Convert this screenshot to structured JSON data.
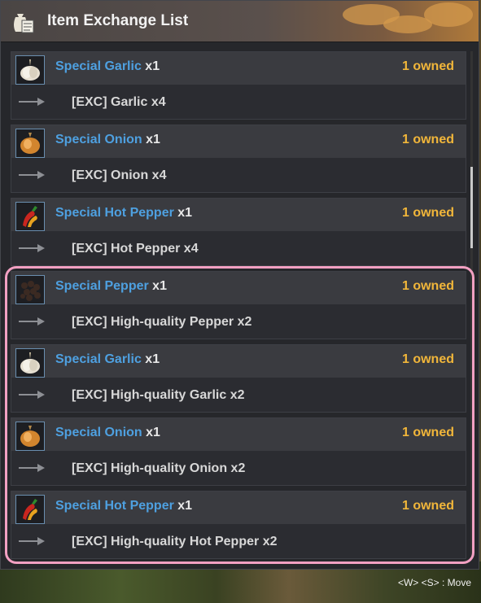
{
  "window": {
    "title": "Item Exchange List",
    "title_icon": "sack-scroll-icon"
  },
  "entries": [
    {
      "name": "Special Garlic",
      "qty": "x1",
      "owned": "1 owned",
      "exchange": "[EXC] Garlic",
      "exchange_qty": "x4",
      "icon": "garlic-icon"
    },
    {
      "name": "Special Onion",
      "qty": "x1",
      "owned": "1 owned",
      "exchange": "[EXC] Onion",
      "exchange_qty": "x4",
      "icon": "onion-icon"
    },
    {
      "name": "Special Hot Pepper",
      "qty": "x1",
      "owned": "1 owned",
      "exchange": "[EXC] Hot Pepper",
      "exchange_qty": "x4",
      "icon": "hot-pepper-icon"
    },
    {
      "name": "Special Pepper",
      "qty": "x1",
      "owned": "1 owned",
      "exchange": "[EXC] High-quality Pepper",
      "exchange_qty": "x2",
      "icon": "pepper-icon"
    },
    {
      "name": "Special Garlic",
      "qty": "x1",
      "owned": "1 owned",
      "exchange": "[EXC] High-quality Garlic",
      "exchange_qty": "x2",
      "icon": "garlic-icon"
    },
    {
      "name": "Special Onion",
      "qty": "x1",
      "owned": "1 owned",
      "exchange": "[EXC] High-quality Onion",
      "exchange_qty": "x2",
      "icon": "onion-icon"
    },
    {
      "name": "Special Hot Pepper",
      "qty": "x1",
      "owned": "1 owned",
      "exchange": "[EXC] High-quality Hot Pepper",
      "exchange_qty": "x2",
      "icon": "hot-pepper-icon"
    }
  ],
  "footer": {
    "hint": "<W> <S> : Move"
  },
  "colors": {
    "name": "#4ea0e0",
    "owned": "#f1b63a",
    "highlight": "#f2a0c2"
  }
}
